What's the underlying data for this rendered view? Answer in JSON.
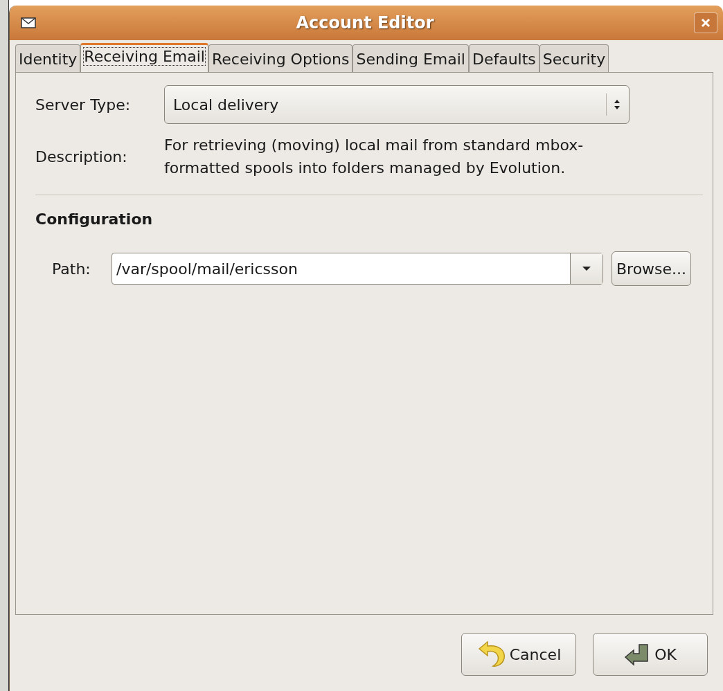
{
  "window": {
    "title": "Account Editor"
  },
  "tabs": [
    {
      "label": "Identity",
      "selected": false
    },
    {
      "label": "Receiving Email",
      "selected": true
    },
    {
      "label": "Receiving Options",
      "selected": false
    },
    {
      "label": "Sending Email",
      "selected": false
    },
    {
      "label": "Defaults",
      "selected": false
    },
    {
      "label": "Security",
      "selected": false
    }
  ],
  "server_type": {
    "label": "Server Type:",
    "value": "Local delivery"
  },
  "description": {
    "label": "Description:",
    "text": "For retrieving (moving) local mail from standard mbox-formatted spools into folders managed by Evolution."
  },
  "configuration": {
    "heading": "Configuration",
    "path": {
      "label": "Path:",
      "value": "/var/spool/mail/ericsson"
    },
    "browse": {
      "label": "Browse..."
    }
  },
  "buttons": [
    {
      "kind": "cancel",
      "label": "Cancel"
    },
    {
      "kind": "ok",
      "label": "OK"
    }
  ]
}
